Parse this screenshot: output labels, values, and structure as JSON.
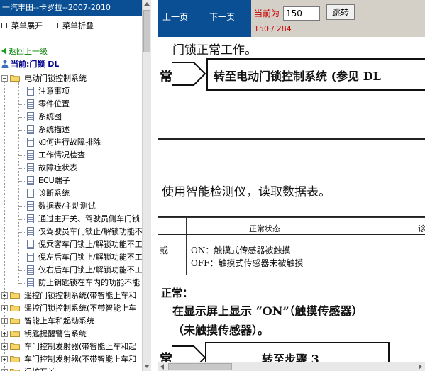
{
  "sidebar": {
    "title": "一汽丰田--卡罗拉--2007-2010",
    "expand_label": "菜单展开",
    "collapse_label": "菜单折叠",
    "back_label": "返回上一级",
    "current_label": "当前:门锁 DL",
    "tree": [
      {
        "label": "电动门锁控制系统",
        "kind": "folder",
        "open": true
      },
      {
        "label": "注意事项",
        "kind": "doc"
      },
      {
        "label": "零件位置",
        "kind": "doc"
      },
      {
        "label": "系统图",
        "kind": "doc"
      },
      {
        "label": "系统描述",
        "kind": "doc"
      },
      {
        "label": "如何进行故障排除",
        "kind": "doc"
      },
      {
        "label": "工作情况检查",
        "kind": "doc"
      },
      {
        "label": "故障症状表",
        "kind": "doc"
      },
      {
        "label": "ECU端子",
        "kind": "doc"
      },
      {
        "label": "诊断系统",
        "kind": "doc"
      },
      {
        "label": "数据表/主动测试",
        "kind": "doc"
      },
      {
        "label": "通过主开关、驾驶员侧车门锁",
        "kind": "doc"
      },
      {
        "label": "仅驾驶员车门锁止/解锁功能不",
        "kind": "doc"
      },
      {
        "label": "倪乘客车门锁止/解锁功能不工",
        "kind": "doc"
      },
      {
        "label": "倪左后车门锁止/解锁功能不工",
        "kind": "doc"
      },
      {
        "label": "仅右后车门锁止/解锁功能不工",
        "kind": "doc"
      },
      {
        "label": "防止钥匙锁在车内的功能不能",
        "kind": "doc"
      },
      {
        "label": "遥控门锁控制系统(带智能上车和",
        "kind": "folder",
        "open": false
      },
      {
        "label": "遥控门锁控制系统(不带智能上车",
        "kind": "folder",
        "open": false
      },
      {
        "label": "智能上车和起动系统",
        "kind": "folder",
        "open": false
      },
      {
        "label": "钥匙提醒警告系统",
        "kind": "folder",
        "open": false
      },
      {
        "label": "车门控制发射器(带智能上车和起",
        "kind": "folder",
        "open": false
      },
      {
        "label": "车门控制发射器(不带智能上车和",
        "kind": "folder",
        "open": false
      },
      {
        "label": "门控开关",
        "kind": "folder",
        "open": false
      }
    ]
  },
  "toolbar": {
    "prev_label": "上一页",
    "next_label": "下一页",
    "current_page_label": "当前为",
    "page_value": "150",
    "jump_label": "跳转",
    "page_count": "150 / 284"
  },
  "document": {
    "line1": "门锁正常工作。",
    "box1_left": "常",
    "box1_text": "转至电动门锁控制系统 (参见 DL",
    "line2": "使用智能检测仪，读取数据表。",
    "table_header_normal": "正常状态",
    "table_header_right": "诊",
    "table_left_cut": "或",
    "table_on": "ON：触摸式传感器被触摸",
    "table_off": "OFF：触摸式传感器未被触摸",
    "normal_label": "正常：",
    "display_line": "在显示屏上显示 “ON”（触摸传感器）",
    "display_line2": "（未触摸传感器）。",
    "box2_left": "常",
    "box2_text": "转至步骤 3"
  },
  "colors": {
    "brand_blue": "#0a4f93",
    "page_red": "#cc0000",
    "back_green": "#008000",
    "current_navy": "#00008b"
  }
}
